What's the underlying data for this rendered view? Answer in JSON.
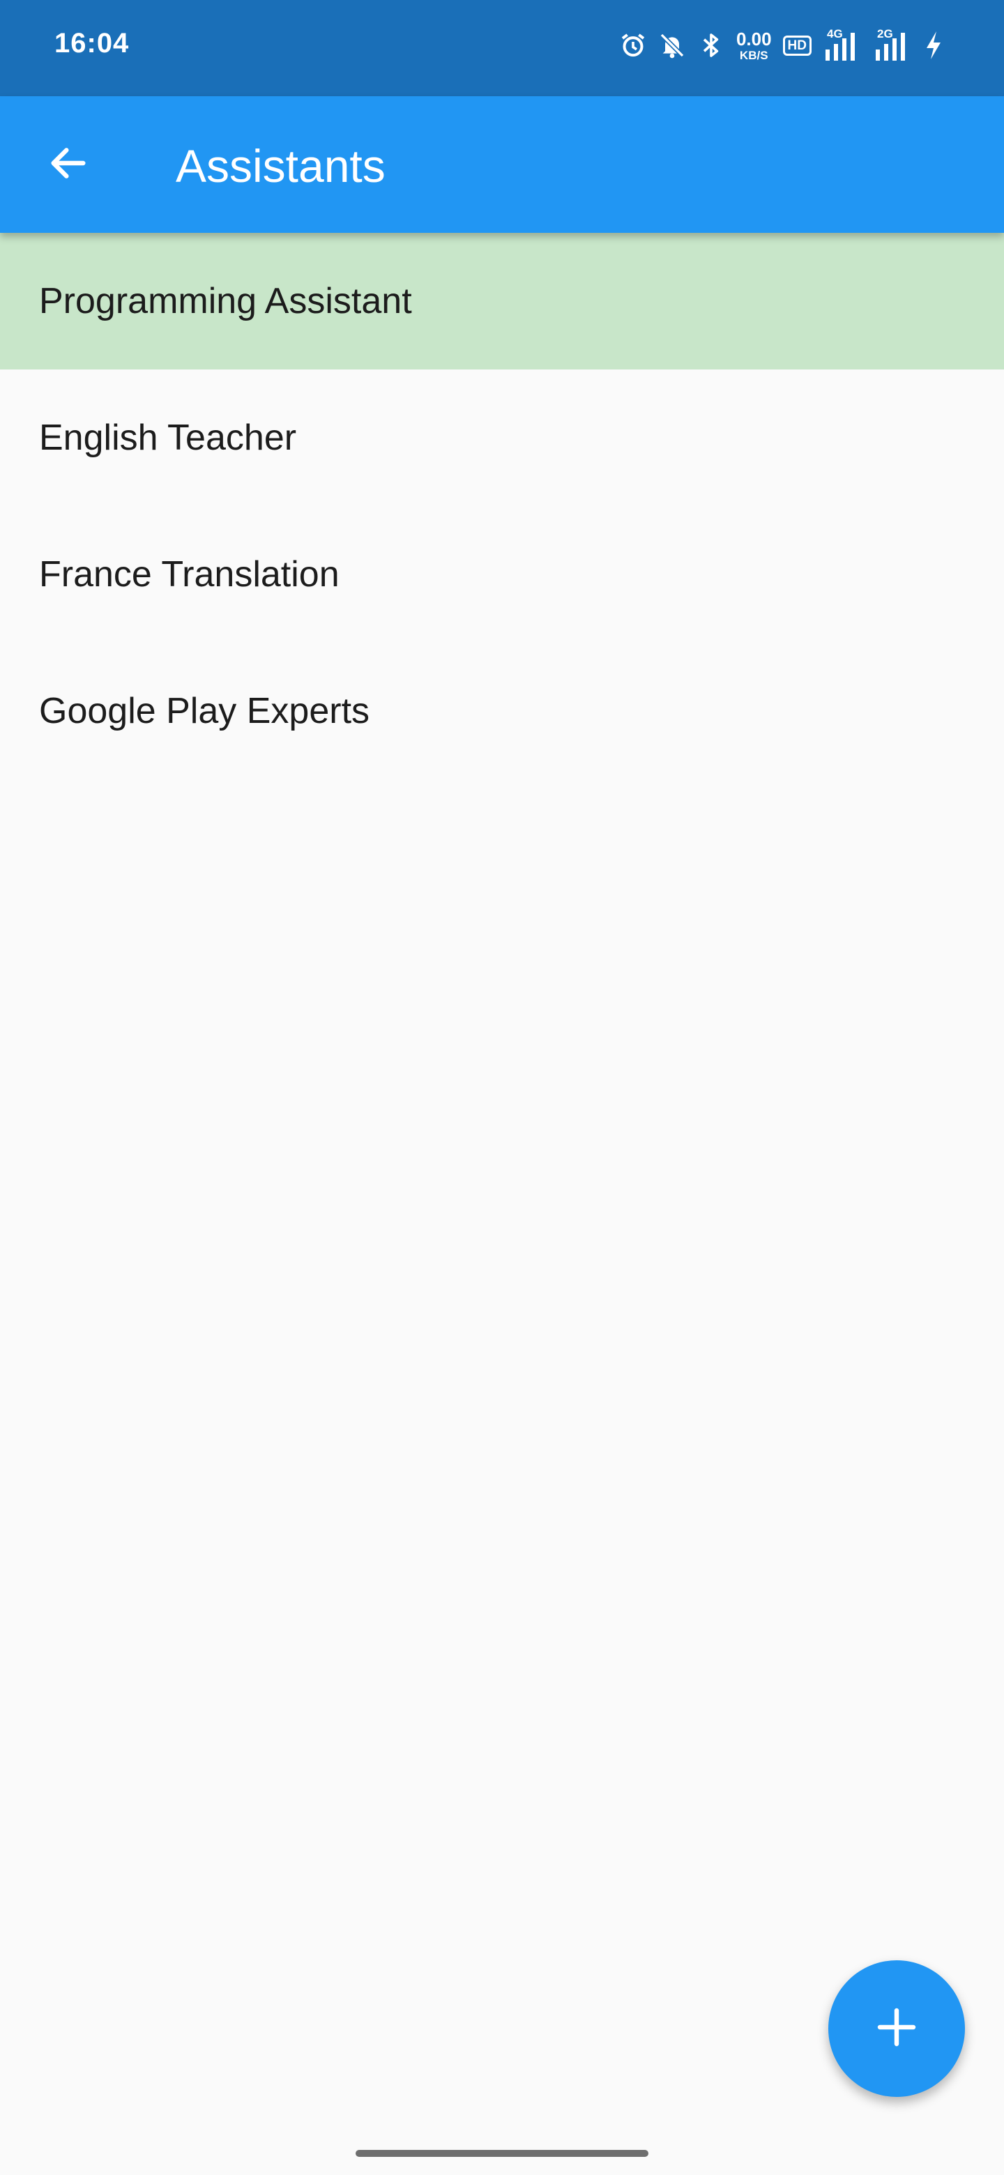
{
  "status_bar": {
    "time": "16:04",
    "net_speed_value": "0.00",
    "net_speed_unit": "KB/S",
    "hd_label": "HD",
    "sim1_label": "4G",
    "sim2_label": "2G",
    "icons": [
      "alarm-icon",
      "mute-icon",
      "bluetooth-icon",
      "hd-icon",
      "signal-4g-icon",
      "signal-2g-icon",
      "charging-icon"
    ]
  },
  "app_bar": {
    "title": "Assistants",
    "back_icon": "arrow-back-icon"
  },
  "assistants": [
    {
      "label": "Programming Assistant",
      "selected": true
    },
    {
      "label": "English Teacher",
      "selected": false
    },
    {
      "label": "France Translation",
      "selected": false
    },
    {
      "label": "Google Play Experts",
      "selected": false
    }
  ],
  "fab": {
    "icon": "plus-icon"
  },
  "colors": {
    "status_bar": "#1a6fb8",
    "app_bar": "#2196f3",
    "selected_item": "#c8e6c9",
    "background": "#fafafa",
    "fab": "#2196f3"
  }
}
